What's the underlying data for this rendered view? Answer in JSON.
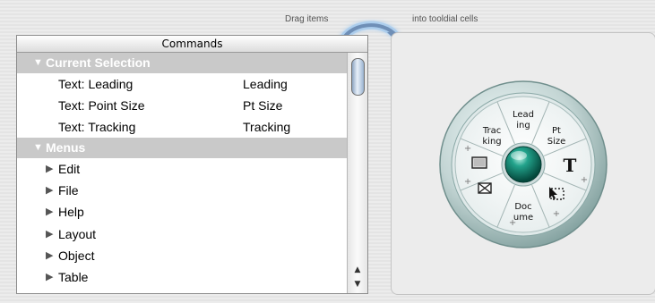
{
  "hint": {
    "left": "Drag items",
    "right": "into tooldial cells"
  },
  "commands": {
    "header": "Commands",
    "groups": [
      {
        "label": "Current Selection",
        "rows": [
          {
            "name": "Text: Leading",
            "short": "Leading"
          },
          {
            "name": "Text: Point Size",
            "short": "Pt Size"
          },
          {
            "name": "Text: Tracking",
            "short": "Tracking"
          }
        ]
      },
      {
        "label": "Menus",
        "items": [
          "Edit",
          "File",
          "Help",
          "Layout",
          "Object",
          "Table"
        ]
      }
    ]
  },
  "dial": {
    "segments": {
      "top": [
        "Lead",
        "ing"
      ],
      "top_right": [
        "Pt",
        "Size"
      ],
      "right": "T",
      "bottom": [
        "Doc",
        "ume"
      ],
      "top_left": [
        "Trac",
        "king"
      ],
      "plus": "+"
    },
    "colors": {
      "center": "#1a8a78",
      "ring": "#aec3c2"
    }
  },
  "icons": {
    "right": "text-T-icon",
    "bottom_right": "selection-icon",
    "bottom_left": "envelope-icon",
    "left": "frame-icon"
  }
}
